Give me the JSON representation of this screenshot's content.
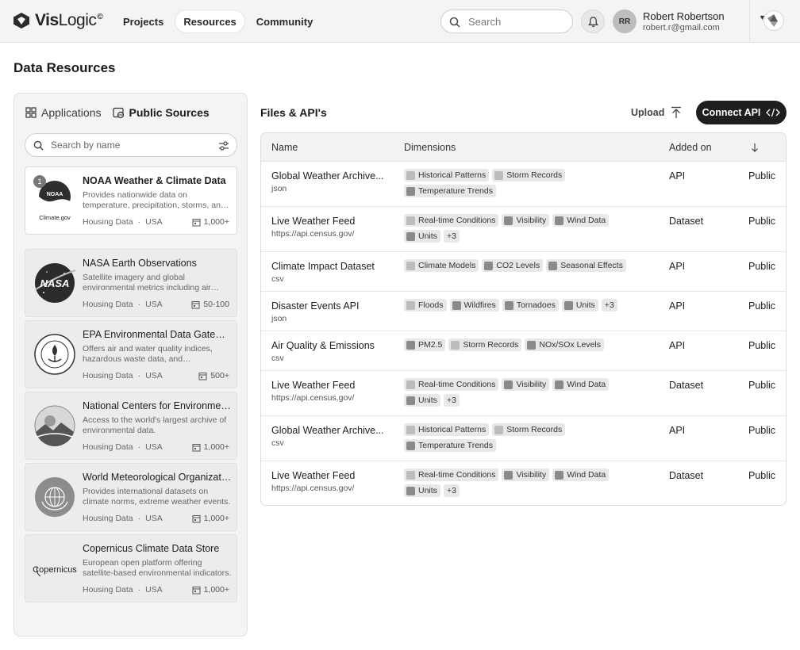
{
  "app": {
    "name_bold": "Vis",
    "name_light": "Logic",
    "mark": "©"
  },
  "nav": [
    {
      "label": "Projects",
      "active": false
    },
    {
      "label": "Resources",
      "active": true
    },
    {
      "label": "Community",
      "active": false
    }
  ],
  "search": {
    "placeholder": "Search"
  },
  "user": {
    "initials": "RR",
    "name": "Robert Robertson",
    "email": "robert.r@gmail.com"
  },
  "page": {
    "title": "Data Resources"
  },
  "left": {
    "tabs": [
      {
        "label": "Applications",
        "icon": "apps-icon",
        "active": false
      },
      {
        "label": "Public Sources",
        "icon": "globe-icon",
        "active": true
      }
    ],
    "search_placeholder": "Search by name",
    "sources": [
      {
        "title": "NOAA Weather & Climate Data",
        "desc": "Provides nationwide data on temperature, precipitation, storms, and more.",
        "category": "Housing Data",
        "region": "USA",
        "count": "1,000+",
        "badge": "1",
        "logo": "noaa",
        "logo_text": "NOAA",
        "logo_caption": "Climate.gov"
      },
      {
        "title": "NASA Earth Observations",
        "desc": "Satellite imagery and global environmental metrics including air quality.",
        "category": "Housing Data",
        "region": "USA",
        "count": "50-100",
        "logo": "nasa",
        "logo_text": "NASA"
      },
      {
        "title": "EPA Environmental Data Gateway",
        "desc": "Offers air and water quality indices, hazardous waste data, and environmental reports.",
        "category": "Housing Data",
        "region": "USA",
        "count": "500+",
        "logo": "epa"
      },
      {
        "title": "National Centers for Environmental Information",
        "desc": "Access to the world's largest archive of environmental data.",
        "category": "Housing Data",
        "region": "USA",
        "count": "1,000+",
        "logo": "ncei"
      },
      {
        "title": "World Meteorological Organization",
        "desc": "Provides international datasets on climate norms, extreme weather events.",
        "category": "Housing Data",
        "region": "USA",
        "count": "1,000+",
        "logo": "wmo"
      },
      {
        "title": "Copernicus Climate Data Store",
        "desc": "European open platform offering satellite-based environmental indicators.",
        "category": "Housing Data",
        "region": "USA",
        "count": "1,000+",
        "logo": "copernicus",
        "logo_text": "Copernicus"
      }
    ]
  },
  "files": {
    "title": "Files & API's",
    "upload_label": "Upload",
    "connect_label": "Connect API",
    "columns": {
      "name": "Name",
      "dimensions": "Dimensions",
      "added": "Added on"
    },
    "rows": [
      {
        "name": "Global Weather Archive...",
        "sub": "json",
        "dims": [
          {
            "label": "Historical Patterns",
            "icon": "light"
          },
          {
            "label": "Storm Records",
            "icon": "light"
          },
          {
            "label": "Temperature Trends",
            "icon": "dark"
          }
        ],
        "added": "API",
        "access": "Public",
        "height": 57
      },
      {
        "name": "Live Weather Feed",
        "sub": "https://api.census.gov/",
        "dims": [
          {
            "label": "Real-time Conditions",
            "icon": "light"
          },
          {
            "label": "Visibility",
            "icon": "dark"
          },
          {
            "label": "Wind Data",
            "icon": "dark"
          },
          {
            "label": "Units",
            "icon": "dark"
          },
          {
            "label": "+3",
            "icon": "none"
          }
        ],
        "added": "Dataset",
        "access": "Public",
        "height": 57
      },
      {
        "name": "Climate Impact Dataset",
        "sub": "csv",
        "dims": [
          {
            "label": "Climate Models",
            "icon": "light"
          },
          {
            "label": "CO2 Levels",
            "icon": "dark"
          },
          {
            "label": "Seasonal Effects",
            "icon": "dark"
          }
        ],
        "added": "API",
        "access": "Public",
        "height": 50
      },
      {
        "name": "Disaster Events API",
        "sub": "json",
        "dims": [
          {
            "label": "Floods",
            "icon": "light"
          },
          {
            "label": "Wildfires",
            "icon": "dark"
          },
          {
            "label": "Tornadoes",
            "icon": "dark"
          },
          {
            "label": "Units",
            "icon": "dark"
          },
          {
            "label": "+3",
            "icon": "none"
          }
        ],
        "added": "API",
        "access": "Public",
        "height": 50
      },
      {
        "name": "Air Quality & Emissions",
        "sub": "csv",
        "dims": [
          {
            "label": "PM2.5",
            "icon": "dark"
          },
          {
            "label": "Storm Records",
            "icon": "light"
          },
          {
            "label": "NOx/SOx Levels",
            "icon": "dark"
          }
        ],
        "added": "API",
        "access": "Public",
        "height": 50
      },
      {
        "name": "Live Weather Feed",
        "sub": "https://api.census.gov/",
        "dims": [
          {
            "label": "Real-time Conditions",
            "icon": "light"
          },
          {
            "label": "Visibility",
            "icon": "dark"
          },
          {
            "label": "Wind Data",
            "icon": "dark"
          },
          {
            "label": "Units",
            "icon": "dark"
          },
          {
            "label": "+3",
            "icon": "none"
          }
        ],
        "added": "Dataset",
        "access": "Public",
        "height": 57
      },
      {
        "name": "Global Weather Archive...",
        "sub": "csv",
        "dims": [
          {
            "label": "Historical Patterns",
            "icon": "light"
          },
          {
            "label": "Storm Records",
            "icon": "light"
          },
          {
            "label": "Temperature Trends",
            "icon": "dark"
          }
        ],
        "added": "API",
        "access": "Public",
        "height": 57
      },
      {
        "name": "Live Weather Feed",
        "sub": "https://api.census.gov/",
        "dims": [
          {
            "label": "Real-time Conditions",
            "icon": "light"
          },
          {
            "label": "Visibility",
            "icon": "dark"
          },
          {
            "label": "Wind Data",
            "icon": "dark"
          },
          {
            "label": "Units",
            "icon": "dark"
          },
          {
            "label": "+3",
            "icon": "none"
          }
        ],
        "added": "Dataset",
        "access": "Public",
        "height": 57
      }
    ]
  }
}
